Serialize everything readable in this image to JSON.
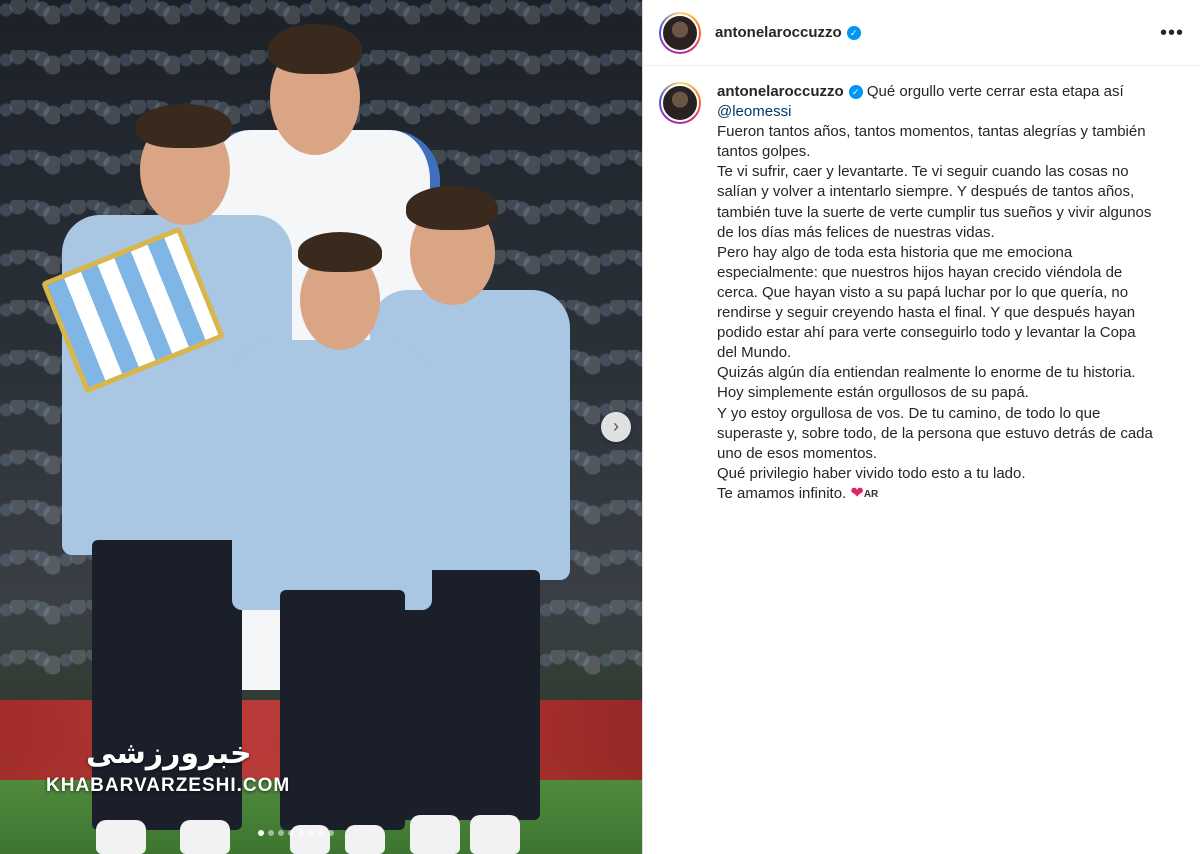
{
  "post": {
    "author": {
      "username": "antonelaroccuzzo",
      "verified": true,
      "verified_icon": "verified-badge-icon"
    },
    "header": {
      "more_label": "•••"
    },
    "caption": {
      "first_line": "Qué orgullo verte cerrar esta etapa así",
      "mention": "@leomessi",
      "paragraphs": [
        "Fueron tantos años, tantos momentos, tantas alegrías y también tantos golpes.",
        "Te vi sufrir, caer y levantarte. Te vi seguir cuando las cosas no salían y volver a intentarlo siempre. Y después de tantos años, también tuve la suerte de verte cumplir tus sueños y vivir algunos de los días más felices de nuestras vidas.",
        "Pero hay algo de toda esta historia que me emociona especialmente: que nuestros hijos hayan crecido viéndola de cerca. Que hayan visto a su papá luchar por lo que quería, no rendirse y seguir creyendo hasta el final. Y que después hayan podido estar ahí para verte conseguirlo todo y levantar la Copa del Mundo.",
        "Quizás algún día entiendan realmente lo enorme de tu historia.",
        "Hoy simplemente están orgullosos de su papá.",
        "Y yo estoy orgullosa de vos. De tu camino, de todo lo que superaste y, sobre todo, de la persona que estuvo detrás de cada uno de esos momentos.",
        "Qué privilegio haber vivido todo esto a tu lado."
      ],
      "closing": "Te amamos infinito.",
      "closing_emoji": "❤",
      "closing_flag": "AR"
    },
    "media": {
      "watermark_arabic": "خبرورزشی",
      "watermark_latin": "KHABARVARZESHI.COM",
      "next_icon": "chevron-right-icon",
      "next_glyph": "›",
      "carousel_count": 8,
      "carousel_active_index": 0
    }
  }
}
